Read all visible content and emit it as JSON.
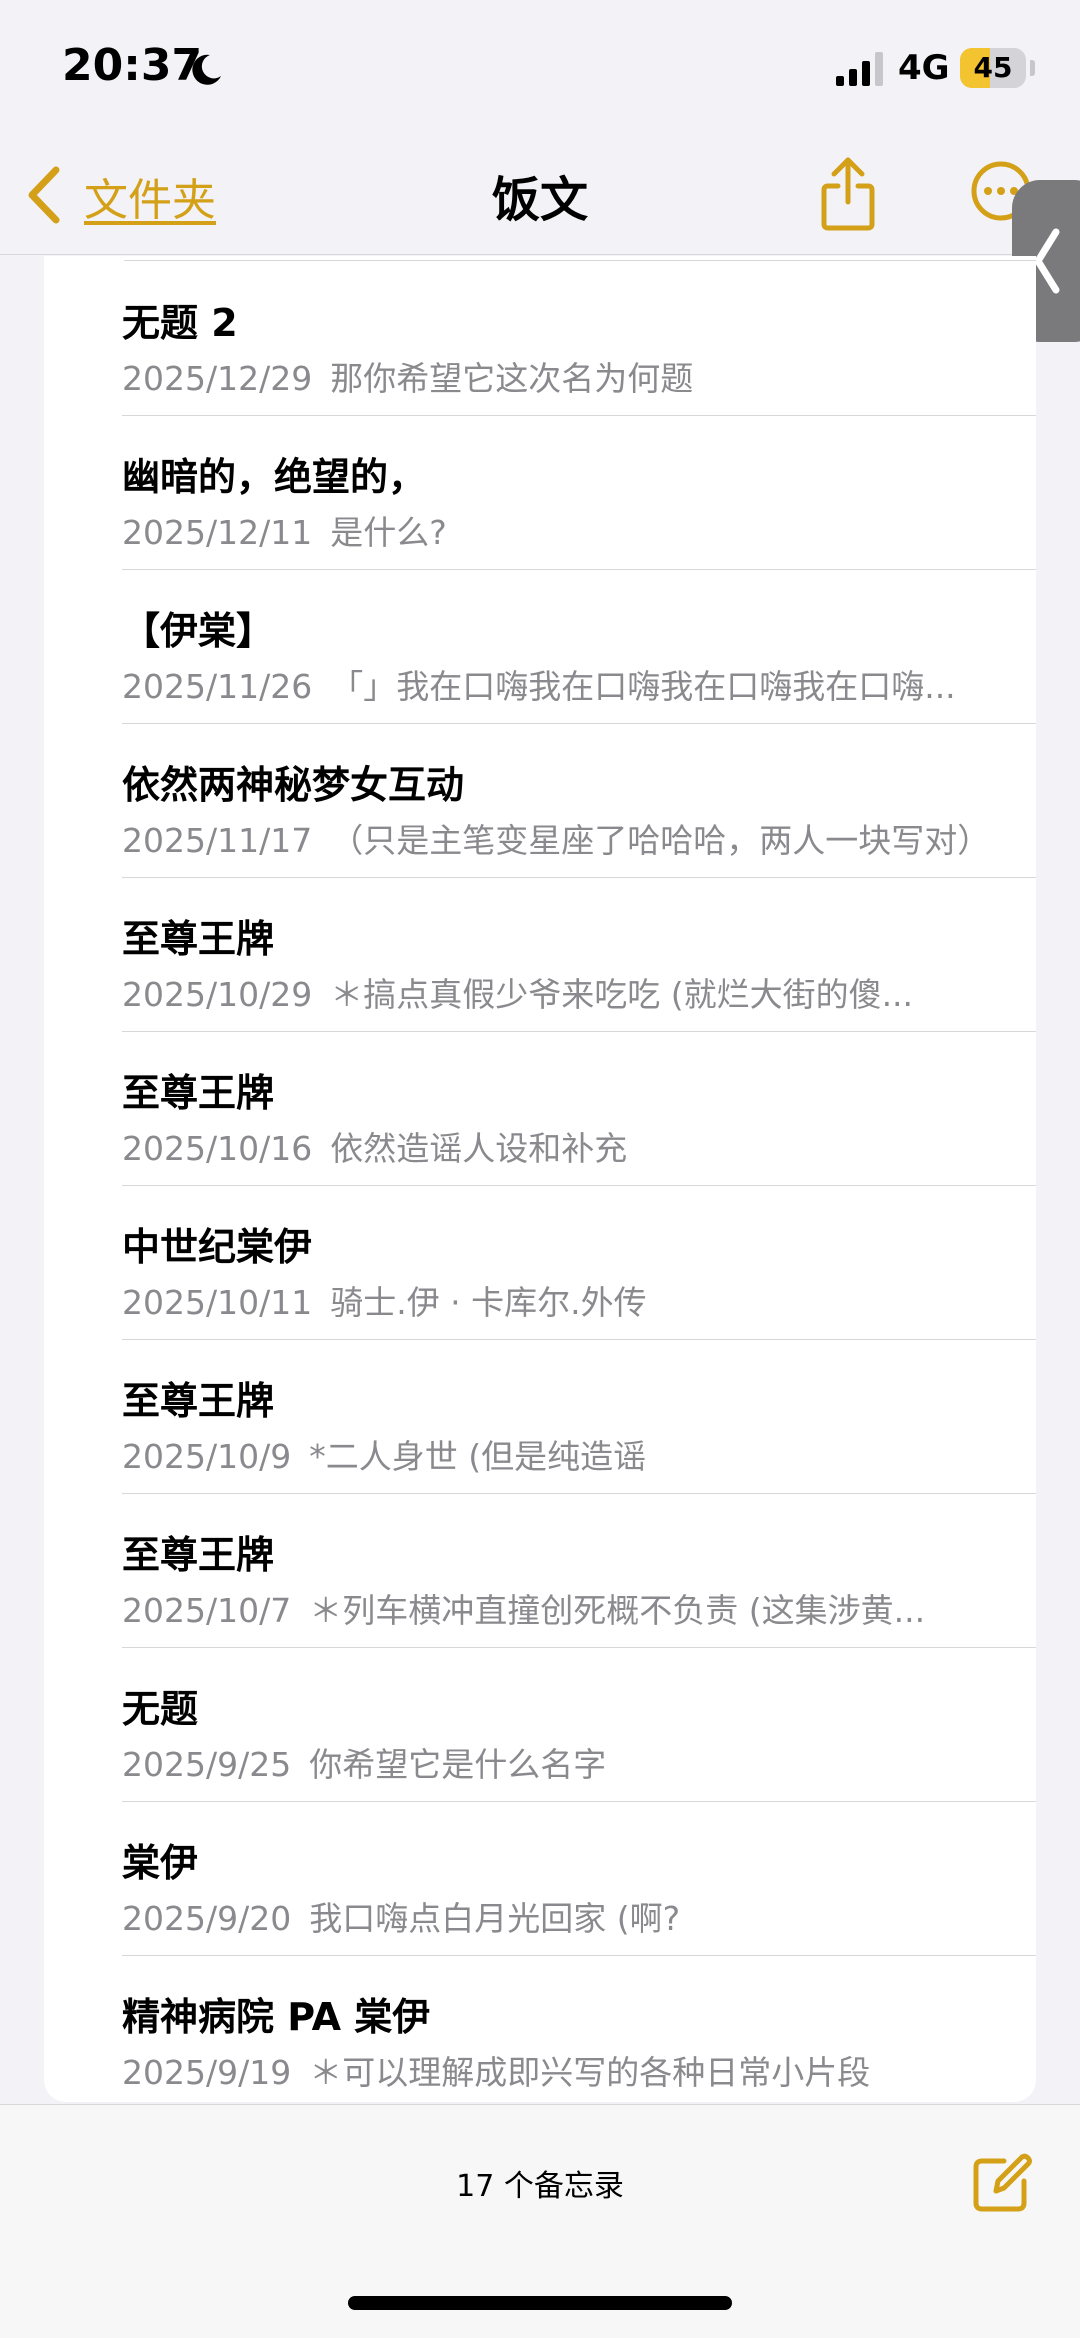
{
  "status": {
    "time": "20:37",
    "network": "4G",
    "battery_text": "45",
    "battery_level": 0.45
  },
  "nav": {
    "back_label": "文件夹",
    "title": "饭文"
  },
  "notes": [
    {
      "title": "无题 2",
      "date": "2025/12/29",
      "preview": "那你希望它这次名为何题"
    },
    {
      "title": "幽暗的，绝望的，",
      "date": "2025/12/11",
      "preview": "是什么?"
    },
    {
      "title": "【伊棠】",
      "date": "2025/11/26",
      "preview": "「」我在口嗨我在口嗨我在口嗨我在口嗨..."
    },
    {
      "title": "依然两神秘梦女互动",
      "date": "2025/11/17",
      "preview": "（只是主笔变星座了哈哈哈，两人一块写对）"
    },
    {
      "title": "至尊王牌",
      "date": "2025/10/29",
      "preview": "＊搞点真假少爷来吃吃 (就烂大街的傻..."
    },
    {
      "title": "至尊王牌",
      "date": "2025/10/16",
      "preview": "依然造谣人设和补充"
    },
    {
      "title": "中世纪棠伊",
      "date": "2025/10/11",
      "preview": "骑士.伊 · 卡库尔.外传"
    },
    {
      "title": "至尊王牌",
      "date": "2025/10/9",
      "preview": "*二人身世 (但是纯造谣"
    },
    {
      "title": "至尊王牌",
      "date": "2025/10/7",
      "preview": "＊列车横冲直撞创死概不负责 (这集涉黄..."
    },
    {
      "title": "无题",
      "date": "2025/9/25",
      "preview": "你希望它是什么名字"
    },
    {
      "title": "棠伊",
      "date": "2025/9/20",
      "preview": "我口嗨点白月光回家 (啊?"
    },
    {
      "title": "精神病院 PA 棠伊",
      "date": "2025/9/19",
      "preview": "＊可以理解成即兴写的各种日常小片段"
    }
  ],
  "toolbar": {
    "note_count": "17 个备忘录"
  },
  "icons": {
    "back": "chevron-left-icon",
    "share": "share-icon",
    "more": "ellipsis-circle-icon",
    "compose": "compose-icon",
    "side_tab": "chevron-left-icon",
    "moon": "moon-icon",
    "signal": "signal-icon"
  },
  "colors": {
    "accent": "#d4a017",
    "battery": "#f4c430",
    "secondary_text": "#8a8a8e",
    "background": "#f2f2f7"
  }
}
